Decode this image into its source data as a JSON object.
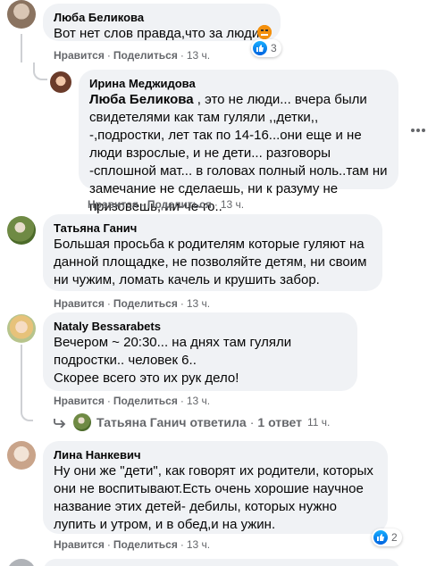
{
  "actions": {
    "like": "Нравится",
    "reply": "Поделиться",
    "dot": "·"
  },
  "comments": [
    {
      "author": "Люба Беликова",
      "text": "Вот нет слов правда,что за люди",
      "time": "13 ч.",
      "reactions": "3"
    },
    {
      "author": "Ирина Меджидова",
      "mention": "Люба Беликова",
      "text": " , это не люди... вчера были свидетелями как там гуляли ,,детки,, -,подростки, лет так по 14-16...они еще и не люди взрослые, и не дети... разговоры -сплошной мат... в головах полный ноль..там ни замечание не сделаешь, ни к разуму не призовешь, ни-че-го..",
      "time": "13 ч."
    },
    {
      "author": "Татьяна Ганич",
      "text": "Большая просьба к родителям которые гуляют на данной площадке, не позволяйте детям, ни своим ни чужим, ломать качель и крушить забор.",
      "time": "13 ч."
    },
    {
      "author": "Nataly Bessarabets",
      "text": "Вечером ~ 20:30... на днях там гуляли подростки.. человек 6..\nСкорее всего это их рук дело!",
      "time": "13 ч."
    },
    {
      "author": "Лина Нанкевич",
      "text": "Ну они же \"дети\", как говорят их родители, которых они не воспитывают.Есть очень хорошие научное название этих детей- дебилы, которых нужно лупить и утром, и в обед,и на ужин.",
      "time": "13 ч.",
      "reactions": "2"
    }
  ],
  "reply_summary": {
    "name": "Татьяна Ганич",
    "verb": "ответила",
    "count": "1 ответ",
    "time": "11 ч."
  },
  "colors": {
    "bubble": "#f0f2f5",
    "secondary_text": "#65676b",
    "like_blue": "#1877f2",
    "thread_line": "#ced0d4"
  },
  "icons": {
    "more": "more-horizontal-icon",
    "like": "thumbs-up-icon",
    "reply_arrow": "reply-arrow-icon"
  }
}
